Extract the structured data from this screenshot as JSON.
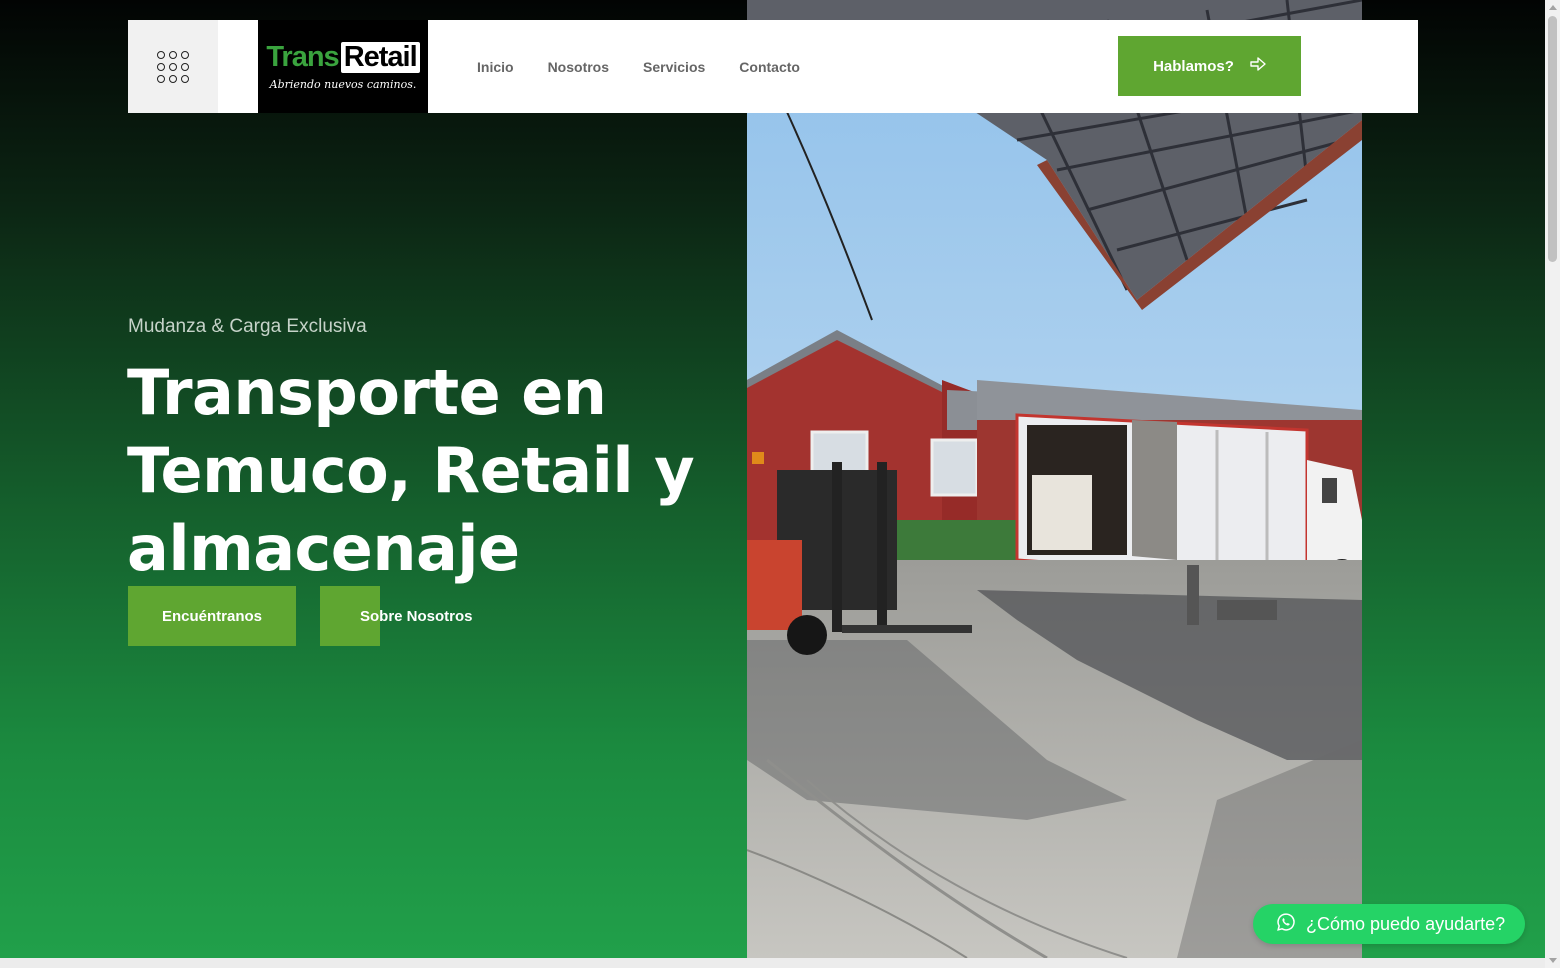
{
  "header": {
    "logo": {
      "brand_part1": "Trans",
      "brand_part2": "Retail",
      "tagline": "Abriendo nuevos caminos."
    },
    "nav": [
      {
        "label": "Inicio"
      },
      {
        "label": "Nosotros"
      },
      {
        "label": "Servicios"
      },
      {
        "label": "Contacto"
      }
    ],
    "cta_label": "Hablamos?",
    "cta_icon": "arrow-right-icon",
    "menu_icon": "grid-dots-icon"
  },
  "hero": {
    "subtitle": "Mudanza & Carga Exclusiva",
    "headline": "Transporte en Temuco, Retail y almacenaje",
    "primary_button": "Encuéntranos",
    "secondary_button": "Sobre Nosotros",
    "image": "warehouse-truck-forklift-photo"
  },
  "whatsapp": {
    "label": "¿Cómo puedo ayudarte?",
    "icon": "whatsapp-icon"
  },
  "colors": {
    "accent": "#5fa631",
    "whatsapp": "#25d366",
    "gradient_top": "#020403",
    "gradient_bottom": "#21a04a"
  }
}
